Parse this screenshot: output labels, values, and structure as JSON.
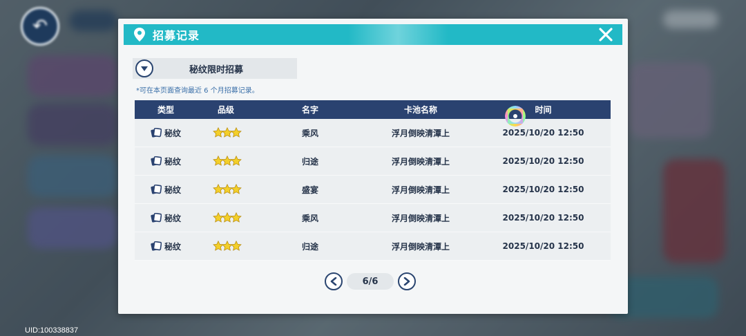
{
  "background": {
    "uid_label": "UID:100338837"
  },
  "dialog": {
    "title": "招募记录",
    "close_icon": "close-icon",
    "pool_selector": {
      "label": "秘纹限时招募",
      "icon": "chevron-down-icon"
    },
    "note": "*可在本页面查询最近 6 个月招募记录。",
    "table": {
      "headers": [
        "类型",
        "品级",
        "名字",
        "卡池名称",
        "时间"
      ],
      "rows": [
        {
          "type": "秘纹",
          "stars": 3,
          "name": "乘风",
          "pool": "浮月倒映清潭上",
          "time": "2025/10/20 12:50"
        },
        {
          "type": "秘纹",
          "stars": 3,
          "name": "归途",
          "pool": "浮月倒映清潭上",
          "time": "2025/10/20 12:50"
        },
        {
          "type": "秘纹",
          "stars": 3,
          "name": "盛宴",
          "pool": "浮月倒映清潭上",
          "time": "2025/10/20 12:50"
        },
        {
          "type": "秘纹",
          "stars": 3,
          "name": "乘风",
          "pool": "浮月倒映清潭上",
          "time": "2025/10/20 12:50"
        },
        {
          "type": "秘纹",
          "stars": 3,
          "name": "归途",
          "pool": "浮月倒映清潭上",
          "time": "2025/10/20 12:50"
        }
      ]
    },
    "pagination": {
      "current": "6/6",
      "prev_icon": "chevron-left-icon",
      "next_icon": "chevron-right-icon"
    }
  },
  "colors": {
    "accent": "#22b9c6",
    "header_bg": "#2a4270",
    "star": "#f3cf2a"
  }
}
